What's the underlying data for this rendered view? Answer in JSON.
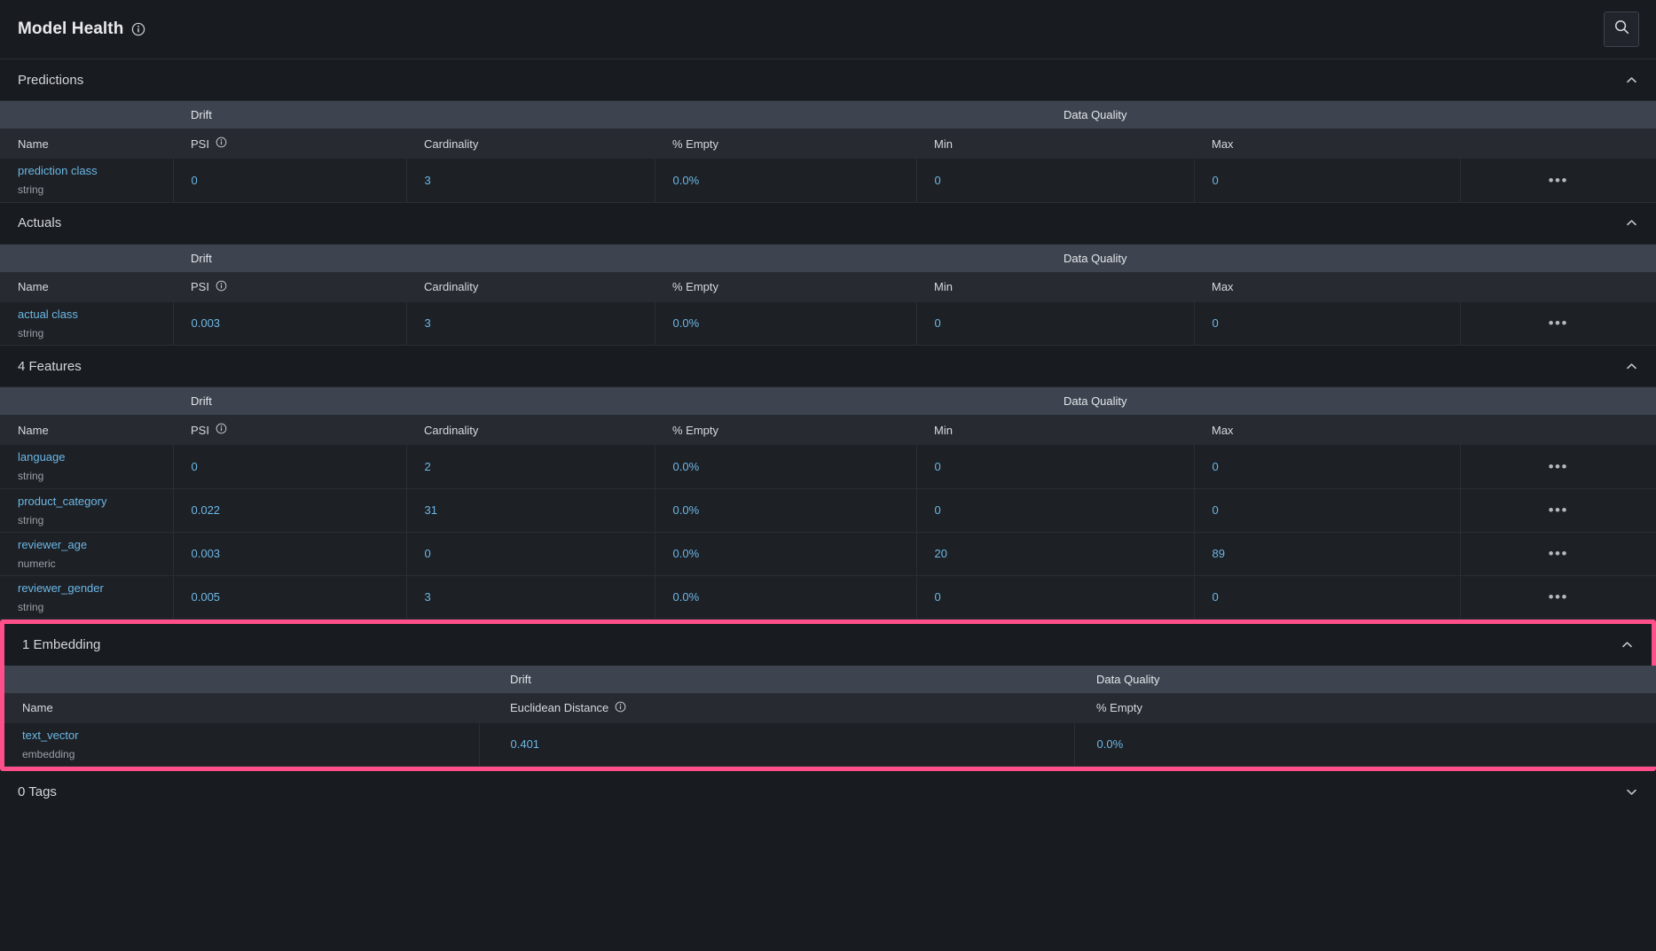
{
  "header": {
    "title": "Model Health",
    "info_icon": "info-icon",
    "search_icon": "search-icon"
  },
  "icons": {
    "chevron_up": "chevron-up-icon",
    "chevron_down": "chevron-down-icon",
    "overflow": "•••"
  },
  "group_headers": {
    "drift": "Drift",
    "data_quality": "Data Quality"
  },
  "columns": {
    "name": "Name",
    "psi": "PSI",
    "cardinality": "Cardinality",
    "pct_empty": "% Empty",
    "min": "Min",
    "max": "Max",
    "euclidean_distance": "Euclidean Distance"
  },
  "sections": [
    {
      "title": "Predictions",
      "expanded": true,
      "rows": [
        {
          "name": "prediction class",
          "type": "string",
          "psi": "0",
          "cardinality": "3",
          "pct_empty": "0.0%",
          "min": "0",
          "max": "0"
        }
      ]
    },
    {
      "title": "Actuals",
      "expanded": true,
      "rows": [
        {
          "name": "actual class",
          "type": "string",
          "psi": "0.003",
          "cardinality": "3",
          "pct_empty": "0.0%",
          "min": "0",
          "max": "0"
        }
      ]
    },
    {
      "title": "4 Features",
      "expanded": true,
      "rows": [
        {
          "name": "language",
          "type": "string",
          "psi": "0",
          "cardinality": "2",
          "pct_empty": "0.0%",
          "min": "0",
          "max": "0"
        },
        {
          "name": "product_category",
          "type": "string",
          "psi": "0.022",
          "cardinality": "31",
          "pct_empty": "0.0%",
          "min": "0",
          "max": "0"
        },
        {
          "name": "reviewer_age",
          "type": "numeric",
          "psi": "0.003",
          "cardinality": "0",
          "pct_empty": "0.0%",
          "min": "20",
          "max": "89"
        },
        {
          "name": "reviewer_gender",
          "type": "string",
          "psi": "0.005",
          "cardinality": "3",
          "pct_empty": "0.0%",
          "min": "0",
          "max": "0"
        }
      ]
    }
  ],
  "embedding_section": {
    "title": "1 Embedding",
    "expanded": true,
    "highlighted": true,
    "highlight_color": "#ff4f8b",
    "rows": [
      {
        "name": "text_vector",
        "type": "embedding",
        "euclidean_distance": "0.401",
        "pct_empty": "0.0%"
      }
    ]
  },
  "tags_section": {
    "title": "0 Tags",
    "expanded": false
  },
  "colors": {
    "page_bg": "#181b1f",
    "group_header_bg": "#3d4450",
    "col_header_bg": "#272b31",
    "row_bg": "#1d2025",
    "link": "#6cb8e6",
    "muted": "#9aa0a8"
  }
}
